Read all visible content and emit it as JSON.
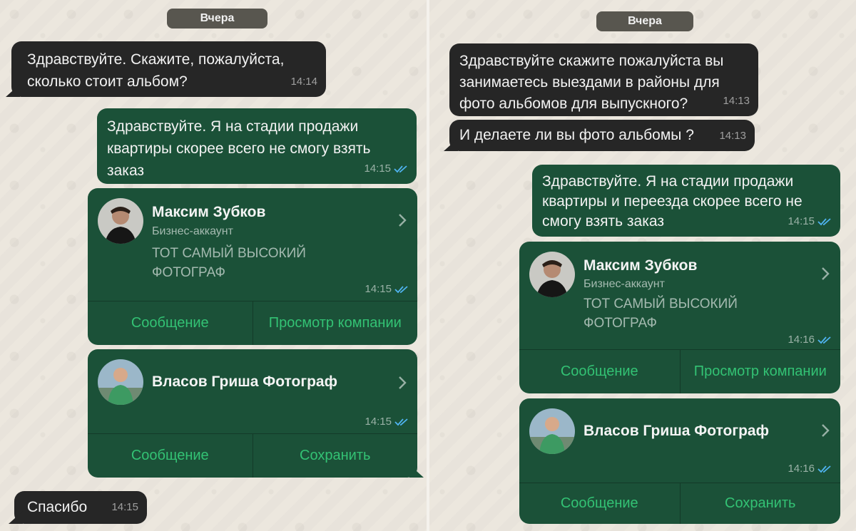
{
  "left": {
    "day": "Вчера",
    "msg1": {
      "text": "Здравствуйте. Скажите, пожалуйста,\nсколько стоит альбом?",
      "time": "14:14"
    },
    "msg2": {
      "text": "Здравствуйте. Я на стадии продажи\nквартиры скорее всего не смогу взять\nзаказ",
      "time": "14:15"
    },
    "card1": {
      "name": "Максим Зубков",
      "subtitle": "Бизнес-аккаунт",
      "description": "ТОТ САМЫЙ ВЫСОКИЙ\nФОТОГРАФ",
      "time": "14:15",
      "action1": "Сообщение",
      "action2": "Просмотр компании"
    },
    "card2": {
      "name": "Власов Гриша Фотограф",
      "time": "14:15",
      "action1": "Сообщение",
      "action2": "Сохранить"
    },
    "msg3": {
      "text": "Спасибо",
      "time": "14:15"
    }
  },
  "right": {
    "day": "Вчера",
    "msg1": {
      "text": "Здравствуйте скажите пожалуйста вы\nзанимаетесь выездами в районы для\nфото альбомов для выпускного?",
      "time": "14:13"
    },
    "msg2": {
      "text": "И делаете ли вы фото альбомы ?",
      "time": "14:13"
    },
    "msg3": {
      "text": "Здравствуйте. Я на стадии продажи\nквартиры и переезда скорее всего не\nсмогу взять заказ",
      "time": "14:15"
    },
    "card1": {
      "name": "Максим Зубков",
      "subtitle": "Бизнес-аккаунт",
      "description": "ТОТ САМЫЙ ВЫСОКИЙ\nФОТОГРАФ",
      "time": "14:16",
      "action1": "Сообщение",
      "action2": "Просмотр компании"
    },
    "card2": {
      "name": "Власов Гриша Фотограф",
      "time": "14:16",
      "action1": "Сообщение",
      "action2": "Сохранить"
    }
  },
  "colors": {
    "incoming": "#262626",
    "outgoing": "#1b5138",
    "accent": "#33c274",
    "read_ticks": "#4fb3f0"
  },
  "icons": {
    "read": "double-check-icon",
    "open": "chevron-right-icon"
  }
}
